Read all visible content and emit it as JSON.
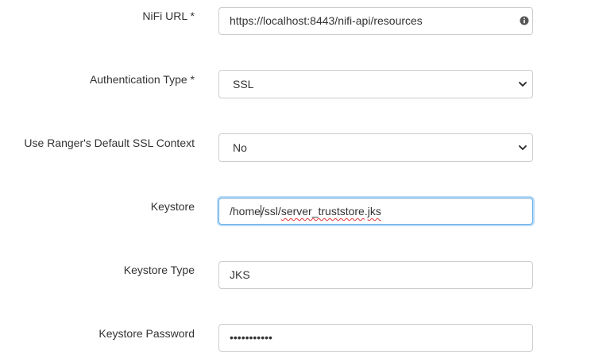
{
  "fields": {
    "nifi_url": {
      "label": "NiFi URL *",
      "value": "https://localhost:8443/nifi-api/resources"
    },
    "auth_type": {
      "label": "Authentication Type *",
      "selected": "SSL"
    },
    "default_ssl": {
      "label": "Use Ranger's Default SSL Context",
      "selected": "No"
    },
    "keystore": {
      "label": "Keystore",
      "value_before_caret": "/home",
      "value_after_caret_plain": "/ssl/",
      "value_misspelled_1": "server_truststore",
      "value_dot": ".",
      "value_misspelled_2": "jks"
    },
    "keystore_type": {
      "label": "Keystore Type",
      "value": "JKS"
    },
    "keystore_password": {
      "label": "Keystore Password",
      "masked_value": "•••••••••••"
    }
  },
  "icons": {
    "info": "info-circle-icon",
    "select_arrow": "chevron-down-icon"
  },
  "colors": {
    "focus_border": "#66afe9",
    "border": "#cccccc",
    "text": "#333333",
    "spellcheck": "#e03131"
  }
}
